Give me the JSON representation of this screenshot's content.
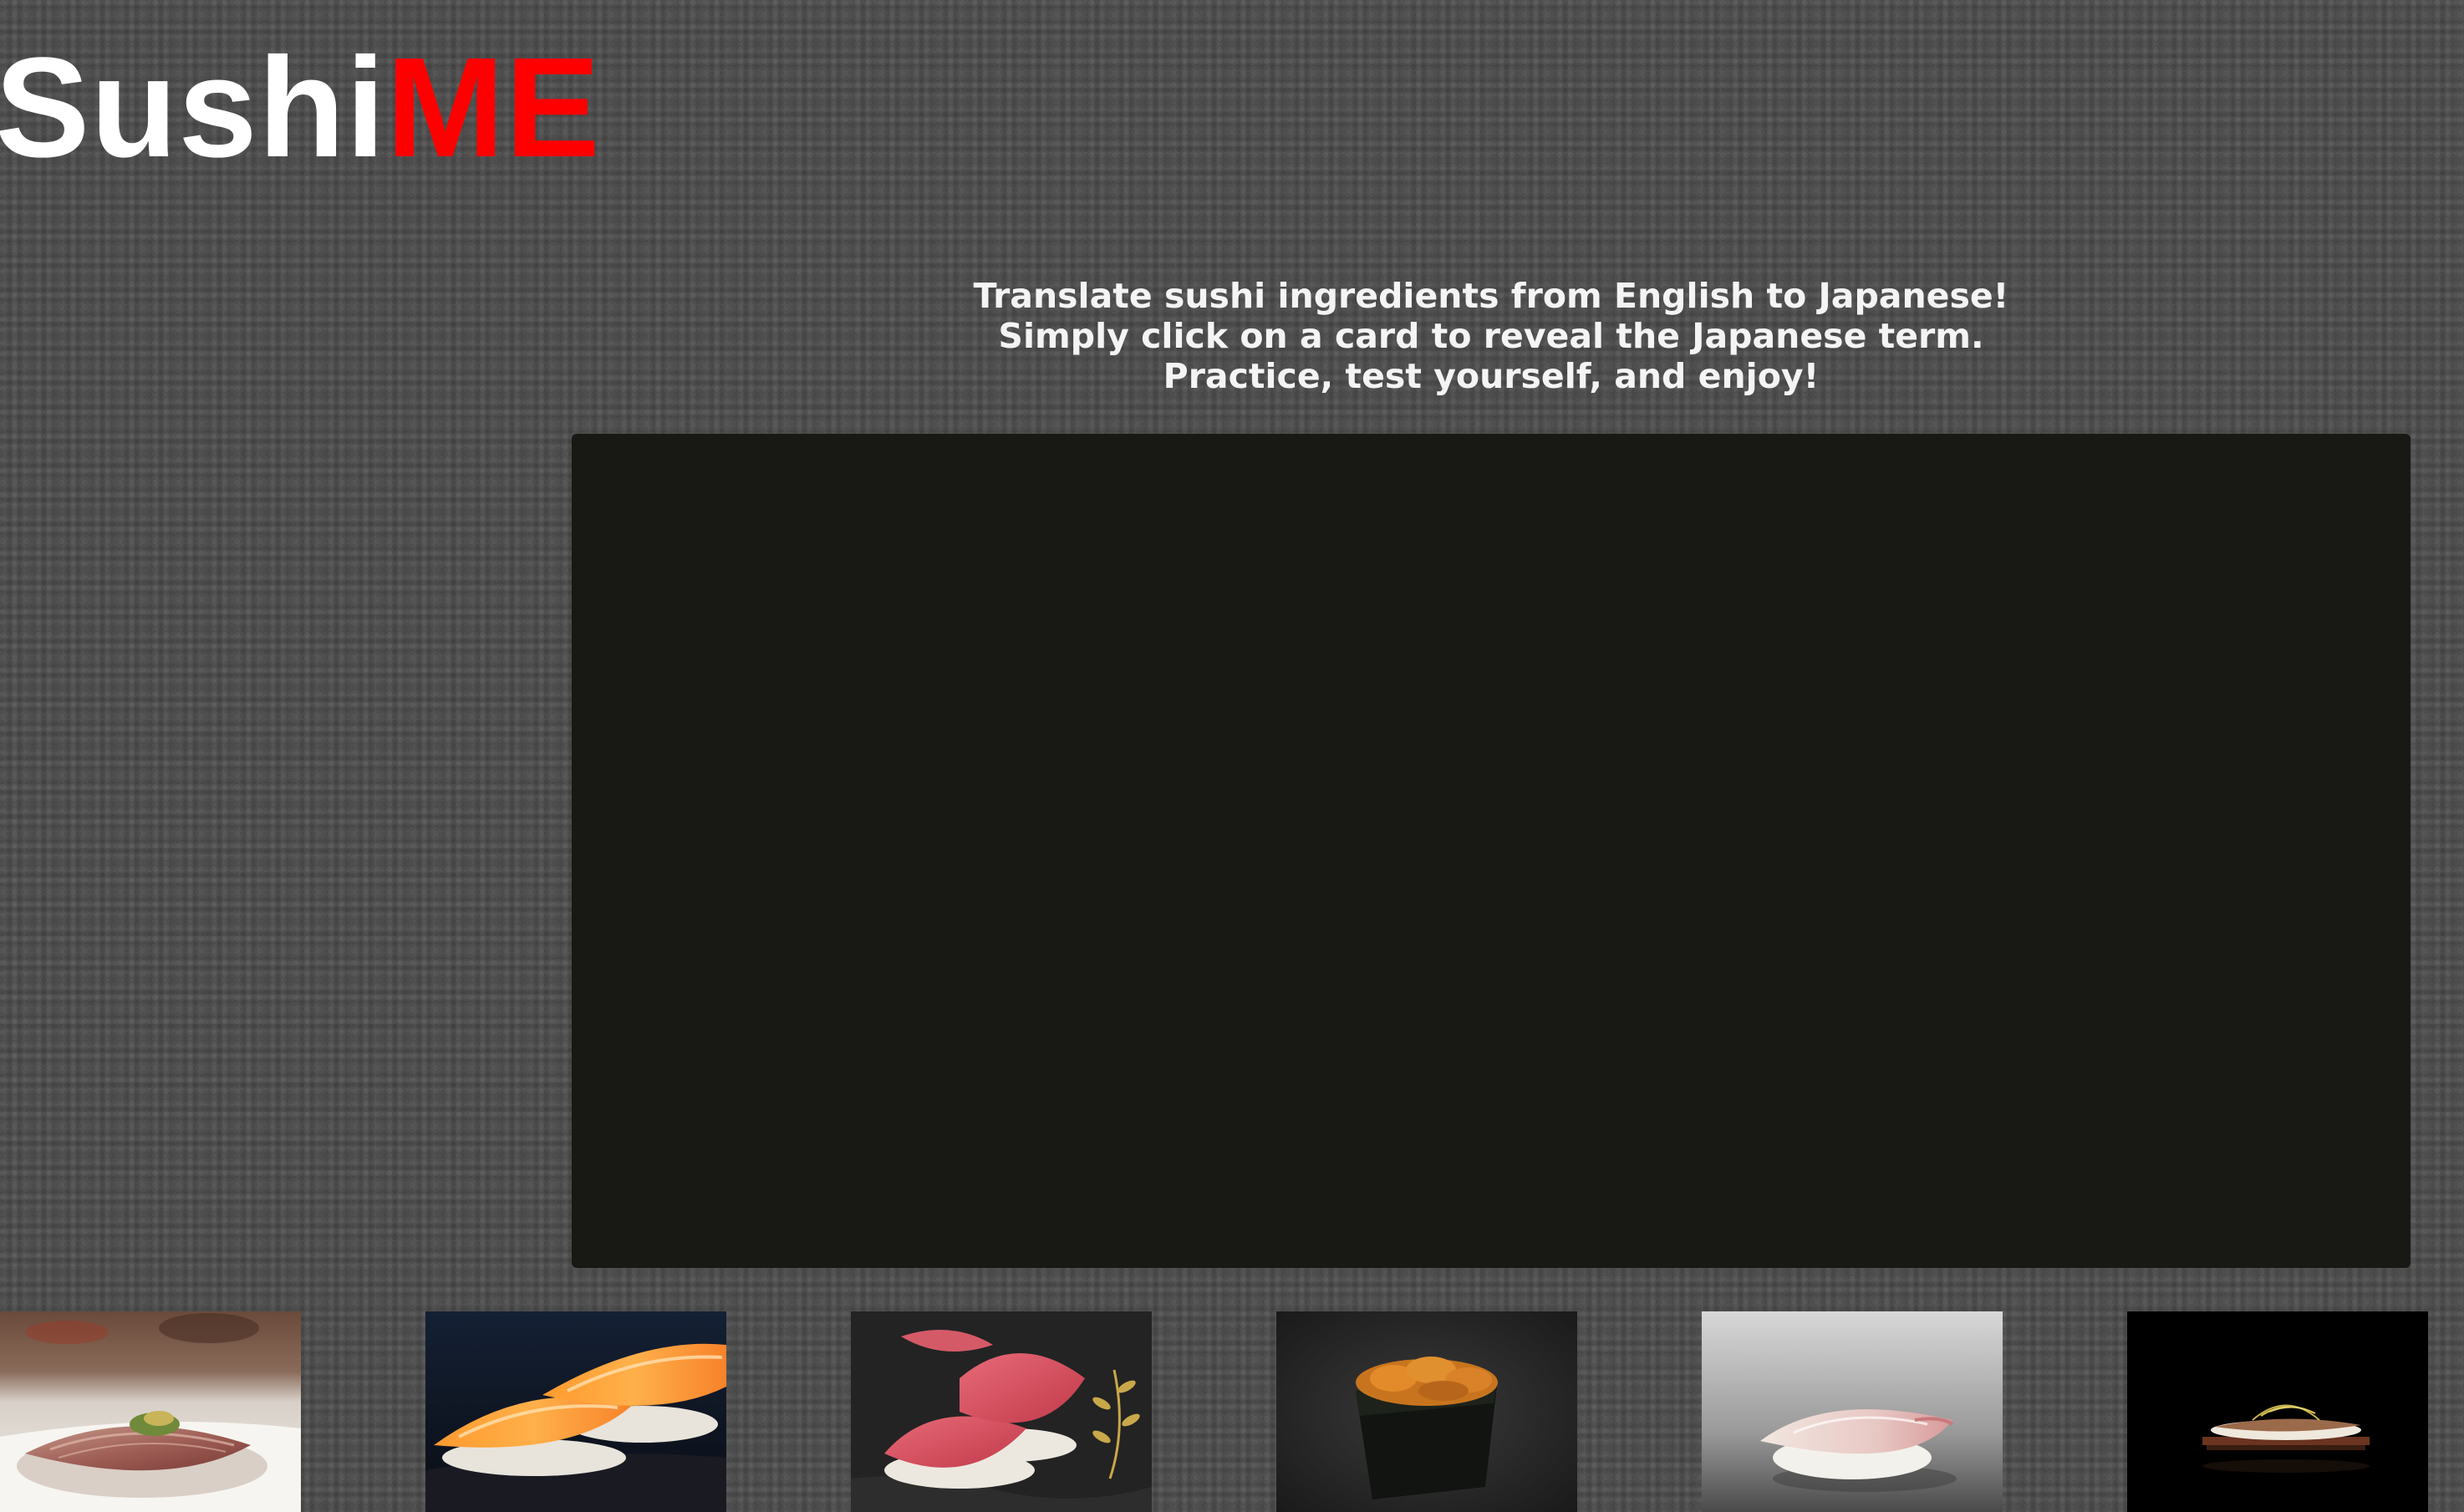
{
  "logo": {
    "part_a": "Sushi",
    "part_b": "ME",
    "colors": {
      "part_a": "#ffffff",
      "part_b": "#ff0000"
    }
  },
  "intro": {
    "lines": [
      "Translate sushi ingredients from English to Japanese!",
      "Simply click on a card to reveal the Japanese term.",
      "Practice, test yourself, and enjoy!"
    ]
  },
  "card_stage": {
    "background": "#181815"
  },
  "thumbnails": [
    {
      "icon": "aji-nigiri-photo"
    },
    {
      "icon": "salmon-nigiri-photo"
    },
    {
      "icon": "tuna-nigiri-photo"
    },
    {
      "icon": "uni-gunkan-photo"
    },
    {
      "icon": "white-fish-nigiri-photo"
    },
    {
      "icon": "anago-nigiri-photo"
    }
  ],
  "colors": {
    "page_background": "#4e4e4e",
    "text": "#f4f4f4",
    "accent": "#ff0000"
  }
}
